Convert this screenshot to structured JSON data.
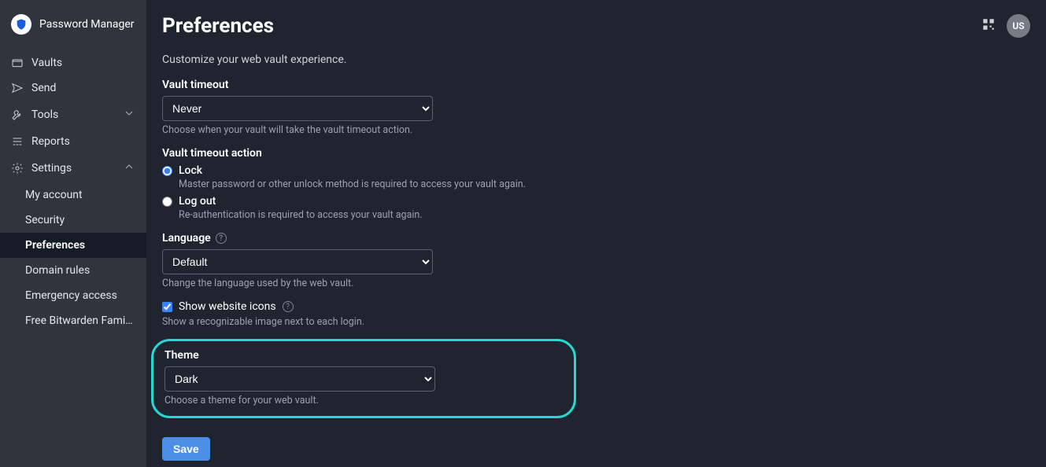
{
  "brand": {
    "name": "Password Manager"
  },
  "header": {
    "avatar_initials": "US"
  },
  "sidebar": {
    "items": [
      {
        "label": "Vaults"
      },
      {
        "label": "Send"
      },
      {
        "label": "Tools"
      },
      {
        "label": "Reports"
      },
      {
        "label": "Settings"
      }
    ],
    "settings_children": [
      {
        "label": "My account"
      },
      {
        "label": "Security"
      },
      {
        "label": "Preferences",
        "active": true
      },
      {
        "label": "Domain rules"
      },
      {
        "label": "Emergency access"
      },
      {
        "label": "Free Bitwarden Famil..."
      }
    ]
  },
  "page": {
    "title": "Preferences",
    "intro": "Customize your web vault experience.",
    "vault_timeout": {
      "label": "Vault timeout",
      "value": "Never",
      "hint": "Choose when your vault will take the vault timeout action."
    },
    "vault_timeout_action": {
      "label": "Vault timeout action",
      "lock": {
        "label": "Lock",
        "hint": "Master password or other unlock method is required to access your vault again."
      },
      "logout": {
        "label": "Log out",
        "hint": "Re-authentication is required to access your vault again."
      }
    },
    "language": {
      "label": "Language",
      "value": "Default",
      "hint": "Change the language used by the web vault."
    },
    "show_icons": {
      "label": "Show website icons",
      "hint": "Show a recognizable image next to each login."
    },
    "theme": {
      "label": "Theme",
      "value": "Dark",
      "hint": "Choose a theme for your web vault."
    },
    "save_label": "Save"
  }
}
